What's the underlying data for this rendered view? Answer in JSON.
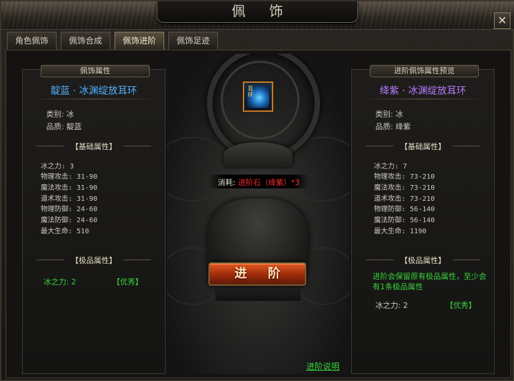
{
  "window": {
    "title": "佩 饰",
    "close_label": "✕"
  },
  "tabs": [
    {
      "label": "角色佩饰"
    },
    {
      "label": "佩饰合成"
    },
    {
      "label": "佩饰进阶"
    },
    {
      "label": "佩饰足迹"
    }
  ],
  "active_tab": 2,
  "colors": {
    "blue_quality": "#4fb2ff",
    "purple_quality": "#b77bff",
    "green_text": "#39d23a",
    "red_text": "#ff2a2a"
  },
  "left_panel": {
    "header": "佩饰属性",
    "item_name": "靛蓝 · 冰渊绽放耳环",
    "type_label": "类别: 冰",
    "quality_label": "品质: 靛蓝",
    "basic_header": "【基础属性】",
    "basic_attrs": [
      "冰之力: 3",
      "物理攻击: 31-90",
      "魔法攻击: 31-90",
      "道术攻击: 31-90",
      "物理防御: 24-60",
      "魔法防御: 24-60",
      "最大生命: 510"
    ],
    "extreme_header": "【极品属性】",
    "extreme_attr": "冰之力: 2",
    "extreme_rank": "【优秀】"
  },
  "right_panel": {
    "header": "进阶佩饰属性预览",
    "item_name": "绛紫 · 冰渊绽放耳环",
    "type_label": "类别: 冰",
    "quality_label": "品质: 绛紫",
    "basic_header": "【基础属性】",
    "basic_attrs": [
      "冰之力: 7",
      "物理攻击: 73-210",
      "魔法攻击: 73-210",
      "道术攻击: 73-210",
      "物理防御: 56-140",
      "魔法防御: 56-140",
      "最大生命: 1190"
    ],
    "extreme_header": "【极品属性】",
    "extreme_note": "进阶会保留原有极品属性，至少会有1条极品属性",
    "extreme_attr": "冰之力: 2",
    "extreme_rank": "【优秀】"
  },
  "center": {
    "item_icon": "earring-item-icon",
    "item_icon_text": "耳环",
    "cost_label": "消耗:",
    "cost_value": "进阶石（绛紫）*3",
    "advance_button": "进 阶",
    "help_link": "进阶说明"
  }
}
